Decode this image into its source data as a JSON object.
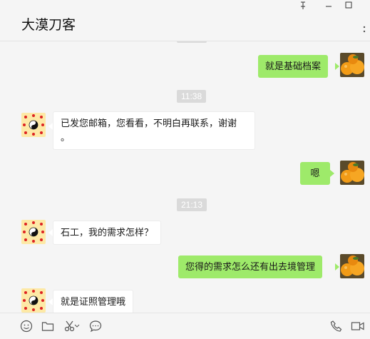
{
  "window": {
    "minimize_glyph": "—",
    "maximize_glyph": "☐",
    "pin_glyph": "⇡"
  },
  "chat": {
    "title": "大漠刀客",
    "more_glyph": "··"
  },
  "messages": [
    {
      "side": "right",
      "text": "就是基础档案"
    },
    {
      "type": "time",
      "text": "11:38"
    },
    {
      "side": "left",
      "text_line1": "已发您邮箱，您看看，不明白再联系，谢谢",
      "text_line2": "。"
    },
    {
      "side": "right",
      "text": "嗯"
    },
    {
      "type": "time",
      "text": "21:13"
    },
    {
      "side": "left",
      "text": "石工，我的需求怎样？"
    },
    {
      "side": "right",
      "text": "您得的需求怎么还有出去境管理"
    },
    {
      "side": "left",
      "text": "就是证照管理哦"
    }
  ],
  "toolbar": {
    "icons": [
      "emoji-icon",
      "folder-icon",
      "scissors-icon",
      "chat-bubble-icon",
      "phone-icon",
      "video-icon"
    ]
  },
  "colors": {
    "bubble_self": "#9eea6a",
    "bubble_other": "#ffffff",
    "background": "#f5f5f5",
    "time_pill": "#dadada"
  }
}
